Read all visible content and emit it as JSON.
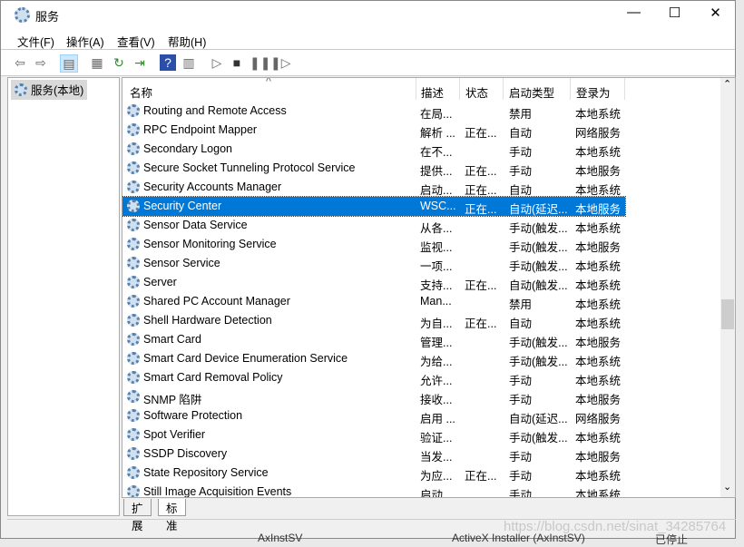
{
  "window": {
    "title": "服务",
    "minimize": "—",
    "maximize": "☐",
    "close": "✕"
  },
  "menu": [
    "文件(F)",
    "操作(A)",
    "查看(V)",
    "帮助(H)"
  ],
  "toolbar_icons": [
    "back-arrow-icon",
    "forward-arrow-icon",
    "show-hide-console-tree-icon",
    "properties-icon",
    "refresh-icon",
    "export-list-icon",
    "help-icon",
    "show-action-pane-icon",
    "start-service-icon",
    "stop-service-icon",
    "pause-service-icon",
    "restart-service-icon"
  ],
  "tree": {
    "item": "服务(本地)"
  },
  "columns": [
    "名称",
    "描述",
    "状态",
    "启动类型",
    "登录为"
  ],
  "rows": [
    [
      "Routing and Remote Access",
      "在局...",
      "",
      "禁用",
      "本地系统"
    ],
    [
      "RPC Endpoint Mapper",
      "解析 ...",
      "正在...",
      "自动",
      "网络服务"
    ],
    [
      "Secondary Logon",
      "在不...",
      "",
      "手动",
      "本地系统"
    ],
    [
      "Secure Socket Tunneling Protocol Service",
      "提供...",
      "正在...",
      "手动",
      "本地服务"
    ],
    [
      "Security Accounts Manager",
      "启动...",
      "正在...",
      "自动",
      "本地系统"
    ],
    [
      "Security Center",
      "WSC...",
      "正在...",
      "自动(延迟...",
      "本地服务"
    ],
    [
      "Sensor Data Service",
      "从各...",
      "",
      "手动(触发...",
      "本地系统"
    ],
    [
      "Sensor Monitoring Service",
      "监视...",
      "",
      "手动(触发...",
      "本地服务"
    ],
    [
      "Sensor Service",
      "一项...",
      "",
      "手动(触发...",
      "本地系统"
    ],
    [
      "Server",
      "支持...",
      "正在...",
      "自动(触发...",
      "本地系统"
    ],
    [
      "Shared PC Account Manager",
      "Man...",
      "",
      "禁用",
      "本地系统"
    ],
    [
      "Shell Hardware Detection",
      "为自...",
      "正在...",
      "自动",
      "本地系统"
    ],
    [
      "Smart Card",
      "管理...",
      "",
      "手动(触发...",
      "本地服务"
    ],
    [
      "Smart Card Device Enumeration Service",
      "为给...",
      "",
      "手动(触发...",
      "本地系统"
    ],
    [
      "Smart Card Removal Policy",
      "允许...",
      "",
      "手动",
      "本地系统"
    ],
    [
      "SNMP 陷阱",
      "接收...",
      "",
      "手动",
      "本地服务"
    ],
    [
      "Software Protection",
      "启用 ...",
      "",
      "自动(延迟...",
      "网络服务"
    ],
    [
      "Spot Verifier",
      "验证...",
      "",
      "手动(触发...",
      "本地系统"
    ],
    [
      "SSDP Discovery",
      "当发...",
      "",
      "手动",
      "本地服务"
    ],
    [
      "State Repository Service",
      "为应...",
      "正在...",
      "手动",
      "本地系统"
    ],
    [
      "Still Image Acquisition Events",
      "启动...",
      "",
      "手动",
      "本地系统"
    ]
  ],
  "selected_row": 5,
  "tabs": [
    "扩展",
    "标准"
  ],
  "active_tab": 1,
  "watermark": "https://blog.csdn.net/sinat_34285764",
  "background_window": {
    "name": "AxInstSV",
    "desc": "ActiveX Installer (AxInstSV)",
    "state": "已停止"
  },
  "colors": {
    "selection": "#0078d7"
  }
}
